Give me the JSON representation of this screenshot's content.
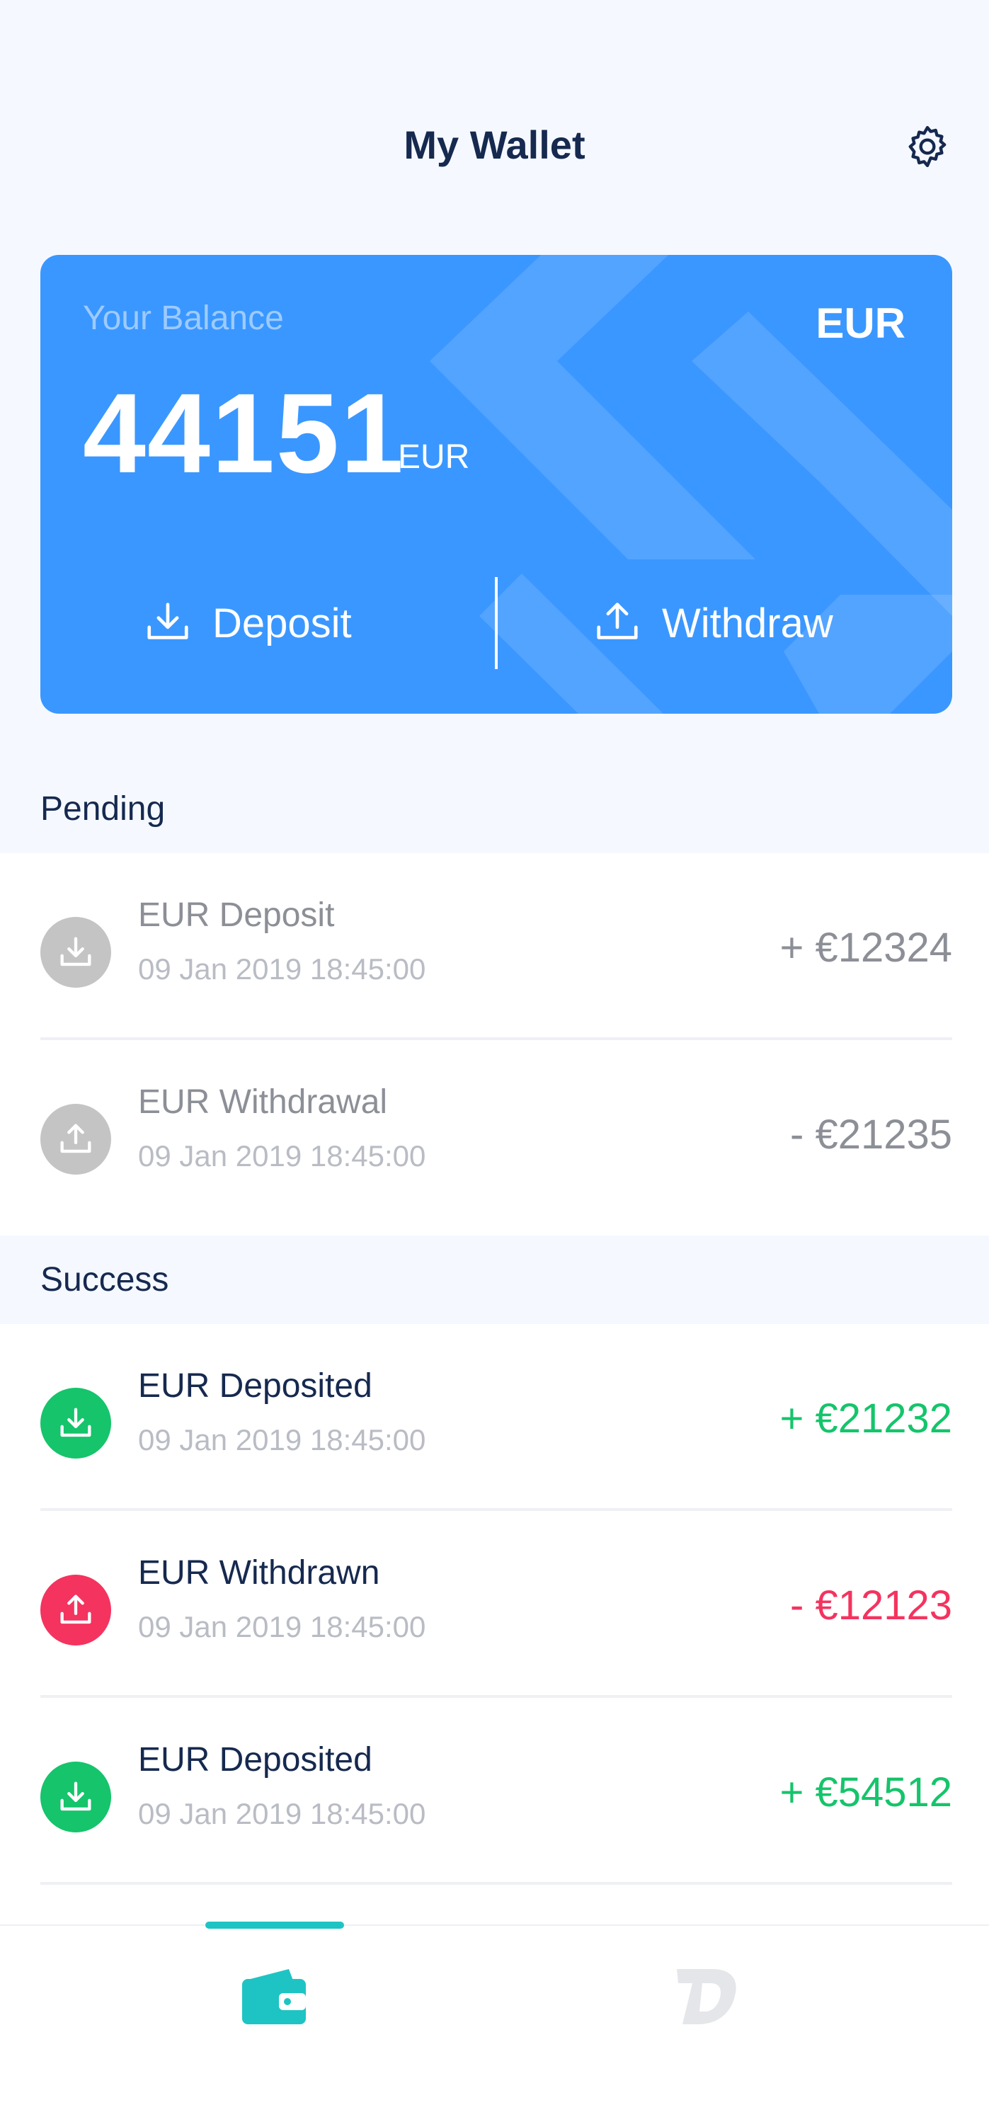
{
  "header": {
    "title": "My Wallet",
    "settings_icon": "gear-icon"
  },
  "balance_card": {
    "label": "Your Balance",
    "currency": "EUR",
    "amount": "44151",
    "amount_unit": "EUR",
    "deposit_label": "Deposit",
    "withdraw_label": "Withdraw",
    "deposit_icon": "download-icon",
    "withdraw_icon": "upload-icon",
    "background_color": "#3a97ff"
  },
  "pending": {
    "title": "Pending",
    "items": [
      {
        "name": "EUR Deposit",
        "date": "09 Jan 2019 18:45:00",
        "amount": "+ €12324",
        "type": "deposit"
      },
      {
        "name": "EUR Withdrawal",
        "date": "09 Jan 2019 18:45:00",
        "amount": "- €21235",
        "type": "withdraw"
      }
    ]
  },
  "success": {
    "title": "Success",
    "items": [
      {
        "name": "EUR Deposited",
        "date": "09 Jan 2019 18:45:00",
        "amount": "+ €21232",
        "type": "deposit"
      },
      {
        "name": "EUR Withdrawn",
        "date": "09 Jan 2019 18:45:00",
        "amount": "- €12123",
        "type": "withdraw"
      },
      {
        "name": "EUR Deposited",
        "date": "09 Jan 2019 18:45:00",
        "amount": "+ €54512",
        "type": "deposit"
      }
    ]
  },
  "colors": {
    "pending_icon": "#c4c4c4",
    "deposit_green": "#15c46b",
    "withdraw_red": "#f4335f",
    "accent_teal": "#1ec4c4",
    "text_dark": "#16294f"
  },
  "bottom_nav": {
    "items": [
      {
        "icon": "wallet-icon",
        "active": true
      },
      {
        "icon": "brand-logo-icon",
        "active": false
      }
    ]
  }
}
